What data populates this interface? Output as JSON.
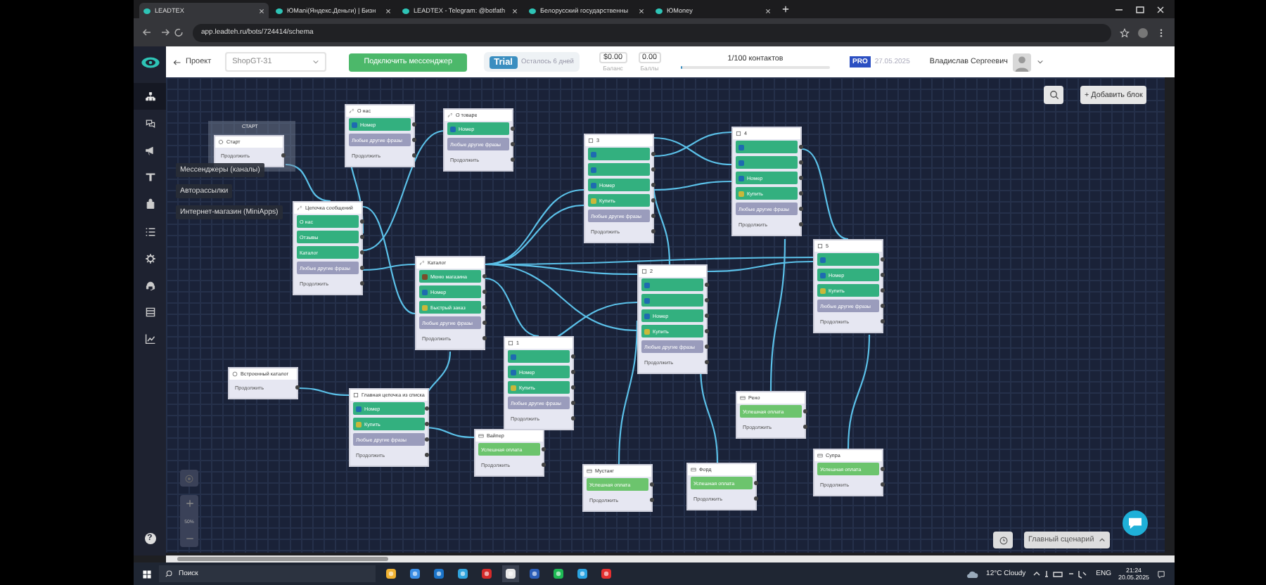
{
  "browser": {
    "tabs": [
      {
        "title": "LEADTEX",
        "selected": true
      },
      {
        "title": "ЮMani(Яндекс.Деньги) | Бизн",
        "selected": false
      },
      {
        "title": "LEADTEX - Telegram: @botfath",
        "selected": false
      },
      {
        "title": "Белорусский государственны",
        "selected": false
      },
      {
        "title": "ЮMoney",
        "selected": false
      }
    ],
    "url": "app.leadteh.ru/bots/724414/schema"
  },
  "header": {
    "back": "Проект",
    "project": "ShopGT-31",
    "connect_button": "Подключить мессенджер",
    "trial": "Trial",
    "trial_left": "Осталось 6 дней",
    "balance": "$0.00",
    "balance_label": "Баланс",
    "points": "0.00",
    "points_label": "Баллы",
    "contacts": "1/100 контактов",
    "contacts_level": {
      "level": 0.01
    },
    "plan": "PRO",
    "plan_date": "27.05.2025",
    "user": "Владислав Сергеевич"
  },
  "sidebar": {
    "items": [
      {
        "selected": true
      },
      {
        "selected": false
      },
      {
        "selected": false
      },
      {
        "selected": false
      },
      {
        "selected": false
      },
      {
        "selected": false
      },
      {
        "selected": false
      },
      {
        "selected": false
      },
      {
        "selected": false
      },
      {
        "selected": false
      }
    ],
    "help": "?"
  },
  "tooltips": [
    "Мессенджеры (каналы)",
    "Авторассылки",
    "Интернет-магазин (MiniApps)"
  ],
  "canvas": {
    "add_block": "+ Добавить блок",
    "zoom": "50%",
    "scenario": "Главный сценарий",
    "start_group": "СТАРТ",
    "nodes": [
      {
        "kind": "start",
        "title": "Старт",
        "items": [
          {
            "kind": "continue",
            "label": "Продолжить"
          }
        ]
      },
      {
        "kind": "chain",
        "title": "О нас",
        "items": [
          {
            "kind": "contact",
            "label": "Номер"
          },
          {
            "kind": "fallback",
            "label": "Любые другие фразы"
          },
          {
            "kind": "continue",
            "label": "Продолжить"
          }
        ]
      },
      {
        "kind": "chain",
        "title": "О товаре",
        "items": [
          {
            "kind": "contact",
            "label": "Номер"
          },
          {
            "kind": "fallback",
            "label": "Любые другие фразы"
          },
          {
            "kind": "continue",
            "label": "Продолжить"
          }
        ]
      },
      {
        "kind": "chain",
        "title": "Цепочка сообщений",
        "items": [
          {
            "kind": "plain",
            "label": "О нас"
          },
          {
            "kind": "plain",
            "label": "Отзывы"
          },
          {
            "kind": "plain",
            "label": "Каталог"
          },
          {
            "kind": "fallback",
            "label": "Любые другие фразы"
          },
          {
            "kind": "continue",
            "label": "Продолжить"
          }
        ]
      },
      {
        "kind": "chain",
        "title": "Каталог",
        "items": [
          {
            "kind": "shop",
            "label": "Меню магазина"
          },
          {
            "kind": "contact",
            "label": "Номер"
          },
          {
            "kind": "buy",
            "label": "Быстрый заказ"
          },
          {
            "kind": "fallback",
            "label": "Любые другие фразы"
          },
          {
            "kind": "continue",
            "label": "Продолжить"
          }
        ]
      },
      {
        "kind": "menu",
        "title": "3",
        "items": [
          {
            "kind": "chat"
          },
          {
            "kind": "chat"
          },
          {
            "kind": "contact",
            "label": "Номер"
          },
          {
            "kind": "buy",
            "label": "Купить"
          },
          {
            "kind": "fallback",
            "label": "Любые другие фразы"
          },
          {
            "kind": "continue",
            "label": "Продолжить"
          }
        ]
      },
      {
        "kind": "menu",
        "title": "4",
        "items": [
          {
            "kind": "chat"
          },
          {
            "kind": "chat"
          },
          {
            "kind": "contact",
            "label": "Номер"
          },
          {
            "kind": "buy",
            "label": "Купить"
          },
          {
            "kind": "fallback",
            "label": "Любые другие фразы"
          },
          {
            "kind": "continue",
            "label": "Продолжить"
          }
        ]
      },
      {
        "kind": "menu",
        "title": "2",
        "items": [
          {
            "kind": "chat"
          },
          {
            "kind": "chat"
          },
          {
            "kind": "contact",
            "label": "Номер"
          },
          {
            "kind": "buy",
            "label": "Купить"
          },
          {
            "kind": "fallback",
            "label": "Любые другие фразы"
          },
          {
            "kind": "continue",
            "label": "Продолжить"
          }
        ]
      },
      {
        "kind": "menu",
        "title": "5",
        "items": [
          {
            "kind": "chat"
          },
          {
            "kind": "contact",
            "label": "Номер"
          },
          {
            "kind": "buy",
            "label": "Купить"
          },
          {
            "kind": "fallback",
            "label": "Любые другие фразы"
          },
          {
            "kind": "continue",
            "label": "Продолжить"
          }
        ]
      },
      {
        "kind": "catalog",
        "title": "Встроенный каталог",
        "items": [
          {
            "kind": "continue",
            "label": "Продолжить"
          }
        ]
      },
      {
        "kind": "menu",
        "title": "Главная цепочка из списка",
        "items": [
          {
            "kind": "contact",
            "label": "Номер"
          },
          {
            "kind": "buy",
            "label": "Купить"
          },
          {
            "kind": "fallback",
            "label": "Любые другие фразы"
          },
          {
            "kind": "continue",
            "label": "Продолжить"
          }
        ]
      },
      {
        "kind": "menu",
        "title": "1",
        "items": [
          {
            "kind": "chat"
          },
          {
            "kind": "contact",
            "label": "Номер"
          },
          {
            "kind": "buy",
            "label": "Купить"
          },
          {
            "kind": "fallback",
            "label": "Любые другие фразы"
          },
          {
            "kind": "continue",
            "label": "Продолжить"
          }
        ]
      },
      {
        "kind": "payment",
        "title": "Вайпер",
        "items": [
          {
            "kind": "success",
            "label": "Успешная оплата"
          },
          {
            "kind": "continue",
            "label": "Продолжить"
          }
        ]
      },
      {
        "kind": "payment",
        "title": "Мустанг",
        "items": [
          {
            "kind": "success",
            "label": "Успешная оплата"
          },
          {
            "kind": "continue",
            "label": "Продолжить"
          }
        ]
      },
      {
        "kind": "payment",
        "title": "Форд",
        "items": [
          {
            "kind": "success",
            "label": "Успешная оплата"
          },
          {
            "kind": "continue",
            "label": "Продолжить"
          }
        ]
      },
      {
        "kind": "payment",
        "title": "Рено",
        "items": [
          {
            "kind": "success",
            "label": "Успешная оплата"
          },
          {
            "kind": "continue",
            "label": "Продолжить"
          }
        ]
      },
      {
        "kind": "payment",
        "title": "Супра",
        "items": [
          {
            "kind": "success",
            "label": "Успешная оплата"
          },
          {
            "kind": "continue",
            "label": "Продолжить"
          }
        ]
      }
    ]
  },
  "taskbar": {
    "search": "Поиск",
    "weather": "12°C Cloudy",
    "lang": "ENG",
    "time": "21:24",
    "date": "20.05.2025"
  }
}
